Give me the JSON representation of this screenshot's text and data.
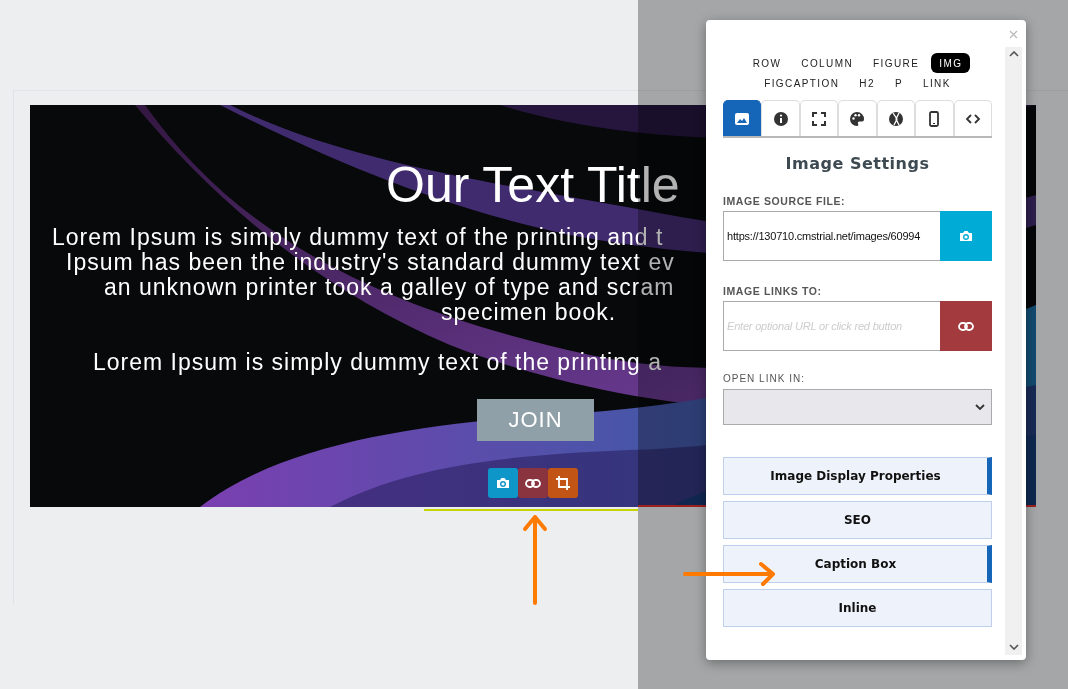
{
  "hero": {
    "kind": "picture",
    "title": "Our Text Title",
    "lines": [
      "Lorem Ipsum is simply dummy text of the printing and t",
      "Ipsum has been the industry's standard dummy text ev",
      "an unknown printer took a galley of type and scram",
      "specimen book.",
      "Lorem Ipsum is simply dummy text of the printing a"
    ],
    "button": "JOIN"
  },
  "panel": {
    "element_tabs": [
      {
        "label": "ROW",
        "selected": false
      },
      {
        "label": "COLUMN",
        "selected": false
      },
      {
        "label": "FIGURE",
        "selected": false
      },
      {
        "label": "IMG",
        "selected": true
      },
      {
        "label": "FIGCAPTION",
        "selected": false
      },
      {
        "label": "H2",
        "selected": false
      },
      {
        "label": "P",
        "selected": false
      },
      {
        "label": "LINK",
        "selected": false
      }
    ],
    "icon_tabs": [
      {
        "selected": true
      },
      {
        "selected": false
      },
      {
        "selected": false
      },
      {
        "selected": false
      },
      {
        "selected": false
      },
      {
        "selected": false
      },
      {
        "selected": false
      }
    ],
    "heading": "Image Settings",
    "source": {
      "label": "IMAGE SOURCE FILE:",
      "value": "https://130710.cmstrial.net/images/60994"
    },
    "link": {
      "label": "IMAGE LINKS TO:",
      "placeholder": "Enter optional URL or click red button"
    },
    "open_in": {
      "label": "OPEN LINK IN:"
    },
    "sections": [
      {
        "label": "Image Display Properties",
        "accent": true
      },
      {
        "label": "SEO",
        "accent": false
      },
      {
        "label": "Caption Box",
        "accent": true
      },
      {
        "label": "Inline",
        "accent": false
      }
    ]
  }
}
